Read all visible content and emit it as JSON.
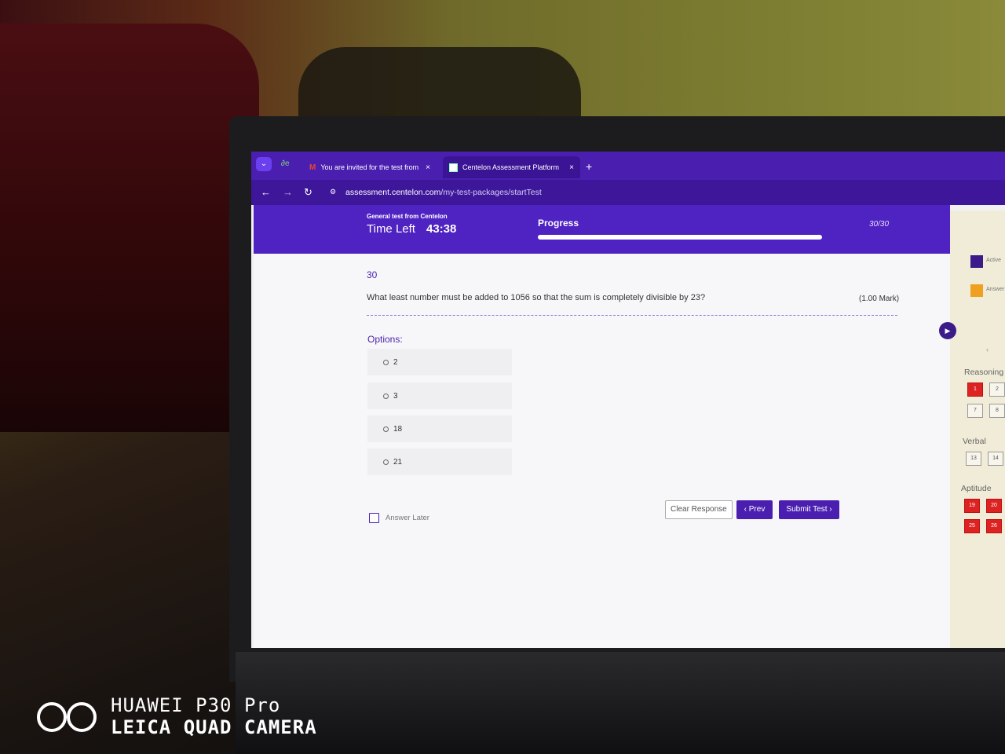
{
  "browser": {
    "tabs": [
      {
        "title": "You are invited for the test from",
        "close": "×"
      },
      {
        "title": "Centelon Assessment Platform",
        "close": "×"
      }
    ],
    "new_tab": "+",
    "url_domain": "assessment.centelon.com",
    "url_path": "/my-test-packages/startTest"
  },
  "header": {
    "subtitle": "General test from Centelon",
    "time_label": "Time Left",
    "time_value": "43:38",
    "progress_label": "Progress",
    "progress_count": "30/30",
    "progress_fraction": 1.0
  },
  "question": {
    "number": "30",
    "text": "What least number must be added to 1056 so that the sum is completely divisible by 23?",
    "mark": "(1.00 Mark)",
    "options_label": "Options:",
    "options": [
      "2",
      "3",
      "18",
      "21"
    ]
  },
  "controls": {
    "answer_later": "Answer Later",
    "clear": "Clear Response",
    "prev": "‹ Prev",
    "submit": "Submit Test ›"
  },
  "sidebar": {
    "legend": [
      "Active",
      "Answer"
    ],
    "sections": [
      {
        "title": "Reasoning",
        "items": [
          "1",
          "2",
          "7",
          "8"
        ]
      },
      {
        "title": "Verbal",
        "items": [
          "13",
          "14"
        ]
      },
      {
        "title": "Aptitude",
        "items": [
          "19",
          "20",
          "25",
          "26"
        ]
      }
    ]
  },
  "watermark": {
    "line1": "HUAWEI P30 Pro",
    "line2": "LEICA QUAD CAMERA"
  },
  "colors": {
    "brand_purple": "#4f22c2",
    "answered_red": "#d22222",
    "answer_later_orange": "#f0a020"
  }
}
